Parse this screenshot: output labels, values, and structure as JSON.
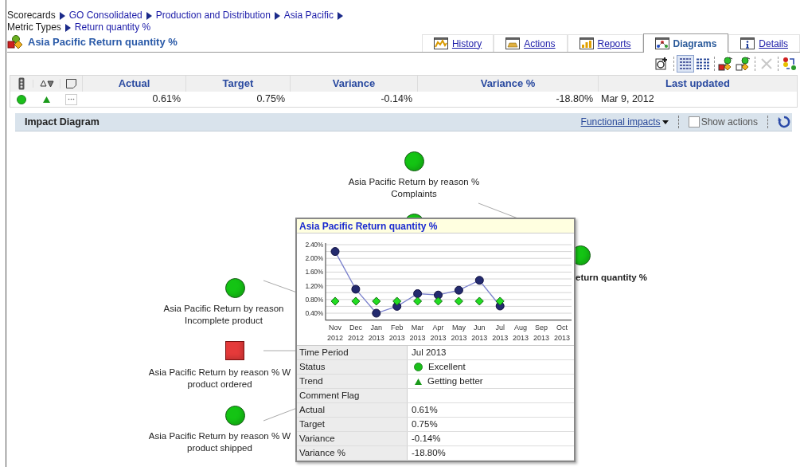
{
  "breadcrumbs": [
    [
      {
        "text": "Scorecards",
        "kind": "plain"
      },
      {
        "text": "GO Consolidated",
        "kind": "link"
      },
      {
        "text": "Production and Distribution",
        "kind": "link"
      },
      {
        "text": "Asia Pacific",
        "kind": "link"
      }
    ],
    [
      {
        "text": "Metric Types",
        "kind": "plain"
      },
      {
        "text": "Return quantity %",
        "kind": "link"
      }
    ]
  ],
  "title": "Asia Pacific Return quantity %",
  "tabs": [
    {
      "label": "History",
      "kind": "history",
      "selected": false
    },
    {
      "label": "Actions",
      "kind": "actions",
      "selected": false
    },
    {
      "label": "Reports",
      "kind": "reports",
      "selected": false
    },
    {
      "label": "Diagrams",
      "kind": "diagrams",
      "selected": true
    },
    {
      "label": "Details",
      "kind": "details",
      "selected": false
    }
  ],
  "toolbar": [
    {
      "kind": "add"
    },
    {
      "kind": "sep"
    },
    {
      "kind": "list",
      "selected": true
    },
    {
      "kind": "grid",
      "selected": false
    },
    {
      "kind": "sep"
    },
    {
      "kind": "node-red"
    },
    {
      "kind": "node-link"
    },
    {
      "kind": "sep"
    },
    {
      "kind": "delete",
      "disabled": true
    },
    {
      "kind": "sep"
    },
    {
      "kind": "reorder"
    }
  ],
  "metric_table": {
    "columns": [
      "Actual",
      "Target",
      "Variance",
      "Variance %",
      "Last updated"
    ],
    "row": {
      "status_dot": {
        "color": "#1bbf1b"
      },
      "trend_arrow": {
        "kind": "up"
      },
      "cells": [
        "0.61%",
        "0.75%",
        "-0.14%",
        "-18.80%",
        "Mar 9, 2012"
      ]
    }
  },
  "impact_bar": {
    "title": "Impact Diagram",
    "menu": "Functional impacts",
    "show_actions": {
      "label": "Show actions",
      "checked": false
    }
  },
  "nodes": [
    {
      "kind": "circle",
      "color": "#14c414",
      "label": [
        "Asia Pacific Return by reason %",
        "Complaints"
      ]
    },
    {
      "kind": "circle",
      "color": "#14c414"
    },
    {
      "kind": "circle",
      "color": "#14c414",
      "label": [
        "eturn quantity %"
      ]
    },
    {
      "kind": "circle",
      "color": "#14c414",
      "label": [
        "Asia Pacific Return by reason",
        "Incomplete product"
      ]
    },
    {
      "kind": "square",
      "color": "#e53a3a",
      "label": [
        "Asia Pacific Return by reason % W",
        "product ordered"
      ]
    },
    {
      "kind": "circle",
      "color": "#14c414",
      "label": [
        "Asia Pacific Return by reason % W",
        "product shipped"
      ]
    }
  ],
  "tooltip": {
    "title": "Asia Pacific Return quantity %",
    "chart_data": {
      "type": "line",
      "categories": [
        "Nov 2012",
        "Dec 2012",
        "Jan 2013",
        "Feb 2013",
        "Mar 2013",
        "Apr 2013",
        "May 2013",
        "Jun 2013",
        "Jul 2013",
        "Aug 2013",
        "Sep 2013",
        "Oct 2013"
      ],
      "series": [
        {
          "type": "line",
          "marker": "circle",
          "color": "#232a6e",
          "values": [
            2.2,
            1.1,
            0.4,
            0.6,
            0.97,
            0.93,
            1.07,
            1.36,
            0.61,
            null,
            null,
            null
          ]
        },
        {
          "type": "scatter",
          "marker": "diamond",
          "color": "#22dd22",
          "values": [
            0.75,
            0.75,
            0.75,
            0.75,
            0.75,
            0.75,
            0.75,
            0.75,
            0.75,
            null,
            null,
            null
          ]
        }
      ],
      "ylim": [
        0.2,
        2.4
      ],
      "grid": true,
      "yticks": [
        {
          "value": 0.4,
          "label": "0.40%"
        },
        {
          "value": 0.8,
          "label": "0.80%"
        },
        {
          "value": 1.2,
          "label": "1.20%"
        },
        {
          "value": 1.6,
          "label": "1.60%"
        },
        {
          "value": 2.0,
          "label": "2.00%"
        },
        {
          "value": 2.4,
          "label": "2.40%"
        }
      ]
    },
    "details": [
      {
        "label": "Time Period",
        "value": "Jul 2013",
        "kind": "text"
      },
      {
        "label": "Status",
        "value": "Excellent",
        "kind": "status",
        "color": "#1bbf1b"
      },
      {
        "label": "Trend",
        "value": "Getting better",
        "kind": "trend-up"
      },
      {
        "label": "Comment Flag",
        "kind": "text"
      },
      {
        "label": "Actual",
        "value": "0.61%",
        "kind": "text"
      },
      {
        "label": "Target",
        "value": "0.75%",
        "kind": "text"
      },
      {
        "label": "Variance",
        "value": "-0.14%",
        "kind": "text"
      },
      {
        "label": "Variance %",
        "value": "-18.80%",
        "kind": "text"
      }
    ]
  }
}
